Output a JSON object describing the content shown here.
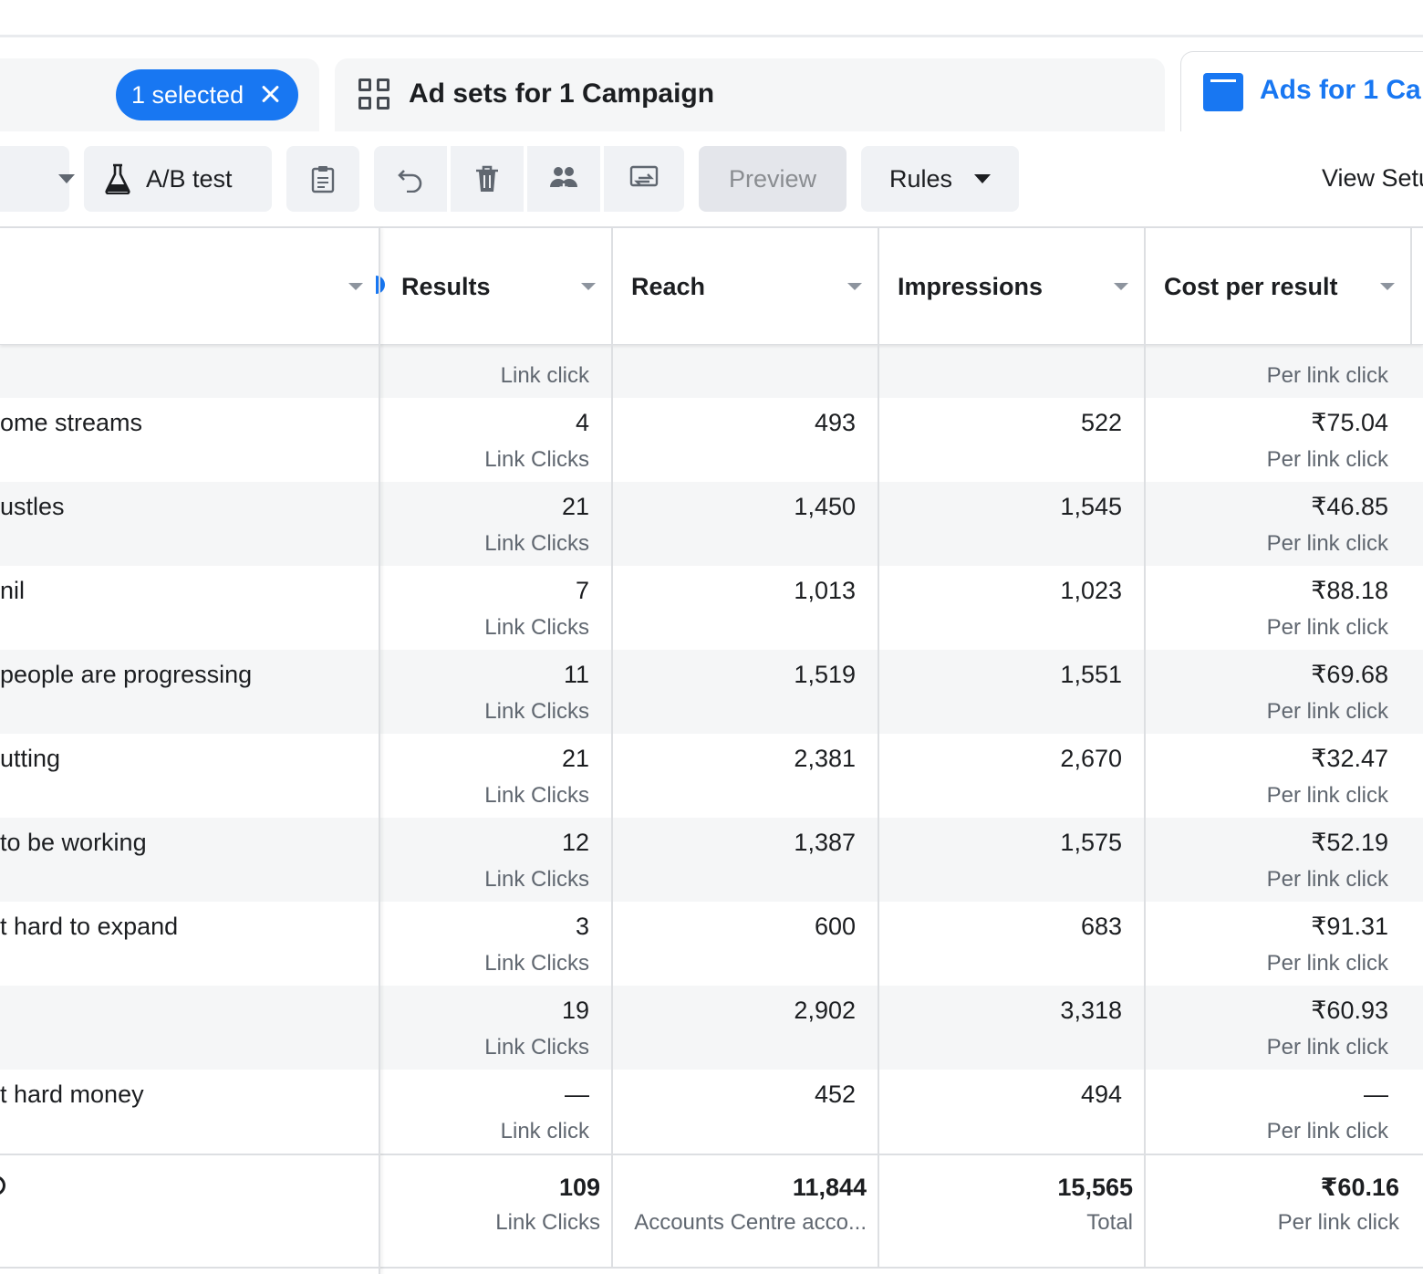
{
  "tabs": {
    "selected_chip": "1 selected",
    "adsets_label": "Ad sets for 1 Campaign",
    "ads_label": "Ads for 1 Ca"
  },
  "toolbar": {
    "ab_test": "A/B test",
    "preview": "Preview",
    "rules": "Rules",
    "view_setup": "View Setu"
  },
  "table": {
    "headers": {
      "results": "Results",
      "reach": "Reach",
      "impressions": "Impressions",
      "cost_per_result": "Cost per result"
    },
    "partial_row": {
      "results_sub": "Link click",
      "cpr_sub": "Per link click"
    },
    "rows": [
      {
        "name": "ome streams",
        "results": "4",
        "results_sub": "Link Clicks",
        "reach": "493",
        "impressions": "522",
        "cpr": "₹75.04",
        "cpr_sub": "Per link click"
      },
      {
        "name": "ustles",
        "results": "21",
        "results_sub": "Link Clicks",
        "reach": "1,450",
        "impressions": "1,545",
        "cpr": "₹46.85",
        "cpr_sub": "Per link click"
      },
      {
        "name": "nil",
        "results": "7",
        "results_sub": "Link Clicks",
        "reach": "1,013",
        "impressions": "1,023",
        "cpr": "₹88.18",
        "cpr_sub": "Per link click"
      },
      {
        "name": "people are progressing",
        "results": "11",
        "results_sub": "Link Clicks",
        "reach": "1,519",
        "impressions": "1,551",
        "cpr": "₹69.68",
        "cpr_sub": "Per link click"
      },
      {
        "name": "utting",
        "results": "21",
        "results_sub": "Link Clicks",
        "reach": "2,381",
        "impressions": "2,670",
        "cpr": "₹32.47",
        "cpr_sub": "Per link click"
      },
      {
        "name": "to be working",
        "results": "12",
        "results_sub": "Link Clicks",
        "reach": "1,387",
        "impressions": "1,575",
        "cpr": "₹52.19",
        "cpr_sub": "Per link click"
      },
      {
        "name": "t hard to expand",
        "results": "3",
        "results_sub": "Link Clicks",
        "reach": "600",
        "impressions": "683",
        "cpr": "₹91.31",
        "cpr_sub": "Per link click"
      },
      {
        "name": "",
        "results": "19",
        "results_sub": "Link Clicks",
        "reach": "2,902",
        "impressions": "3,318",
        "cpr": "₹60.93",
        "cpr_sub": "Per link click"
      },
      {
        "name": "t hard money",
        "results": "—",
        "results_sub": "Link click",
        "reach": "452",
        "impressions": "494",
        "cpr": "—",
        "cpr_sub": "Per link click"
      }
    ],
    "totals": {
      "results": "109",
      "results_sub": "Link Clicks",
      "reach": "11,844",
      "reach_sub": "Accounts Centre acco...",
      "impressions": "15,565",
      "impressions_sub": "Total",
      "cpr": "₹60.16",
      "cpr_sub": "Per link click"
    }
  }
}
